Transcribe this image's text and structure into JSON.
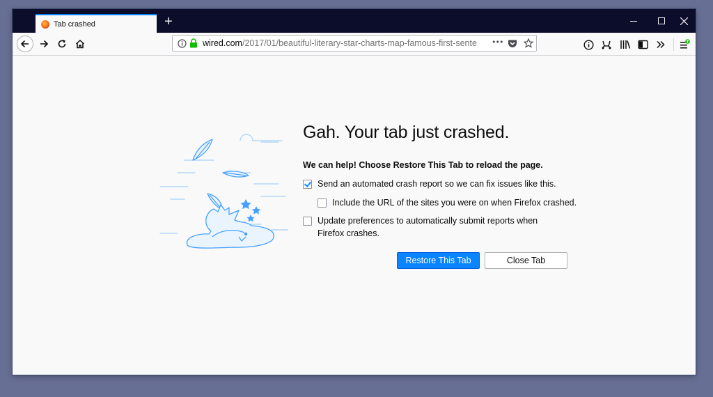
{
  "window": {
    "tab_title": "Tab crashed",
    "new_tab_symbol": "+"
  },
  "toolbar": {
    "url_host": "wired.com",
    "url_path": "/2017/01/beautiful-literary-star-charts-map-famous-first-sente",
    "page_actions_symbol": "•••",
    "icons": [
      "back-icon",
      "forward-icon",
      "reload-icon",
      "home-icon",
      "info-icon",
      "lock-icon",
      "pocket-icon",
      "bookmark-star-icon",
      "tracking-info-icon",
      "screenshot-icon",
      "library-icon",
      "sidebar-icon",
      "overflow-chevrons-icon",
      "menu-hamburger-icon",
      "update-badge-icon"
    ],
    "accent_color": "#0a84ff",
    "lock_color": "#12bc00"
  },
  "crash_page": {
    "title": "Gah. Your tab just crashed.",
    "help_text": "We can help!  Choose Restore This Tab to reload the page.",
    "send_report_label": "Send an automated crash report so we can fix issues like this.",
    "send_report_checked": true,
    "include_url_label": "Include the URL of the sites you were on when Firefox crashed.",
    "include_url_checked": false,
    "auto_submit_label_line1": "Update preferences to automatically submit reports when",
    "auto_submit_label_line2": "Firefox crashes.",
    "auto_submit_checked": false,
    "restore_button": "Restore This Tab",
    "close_button": "Close Tab"
  }
}
